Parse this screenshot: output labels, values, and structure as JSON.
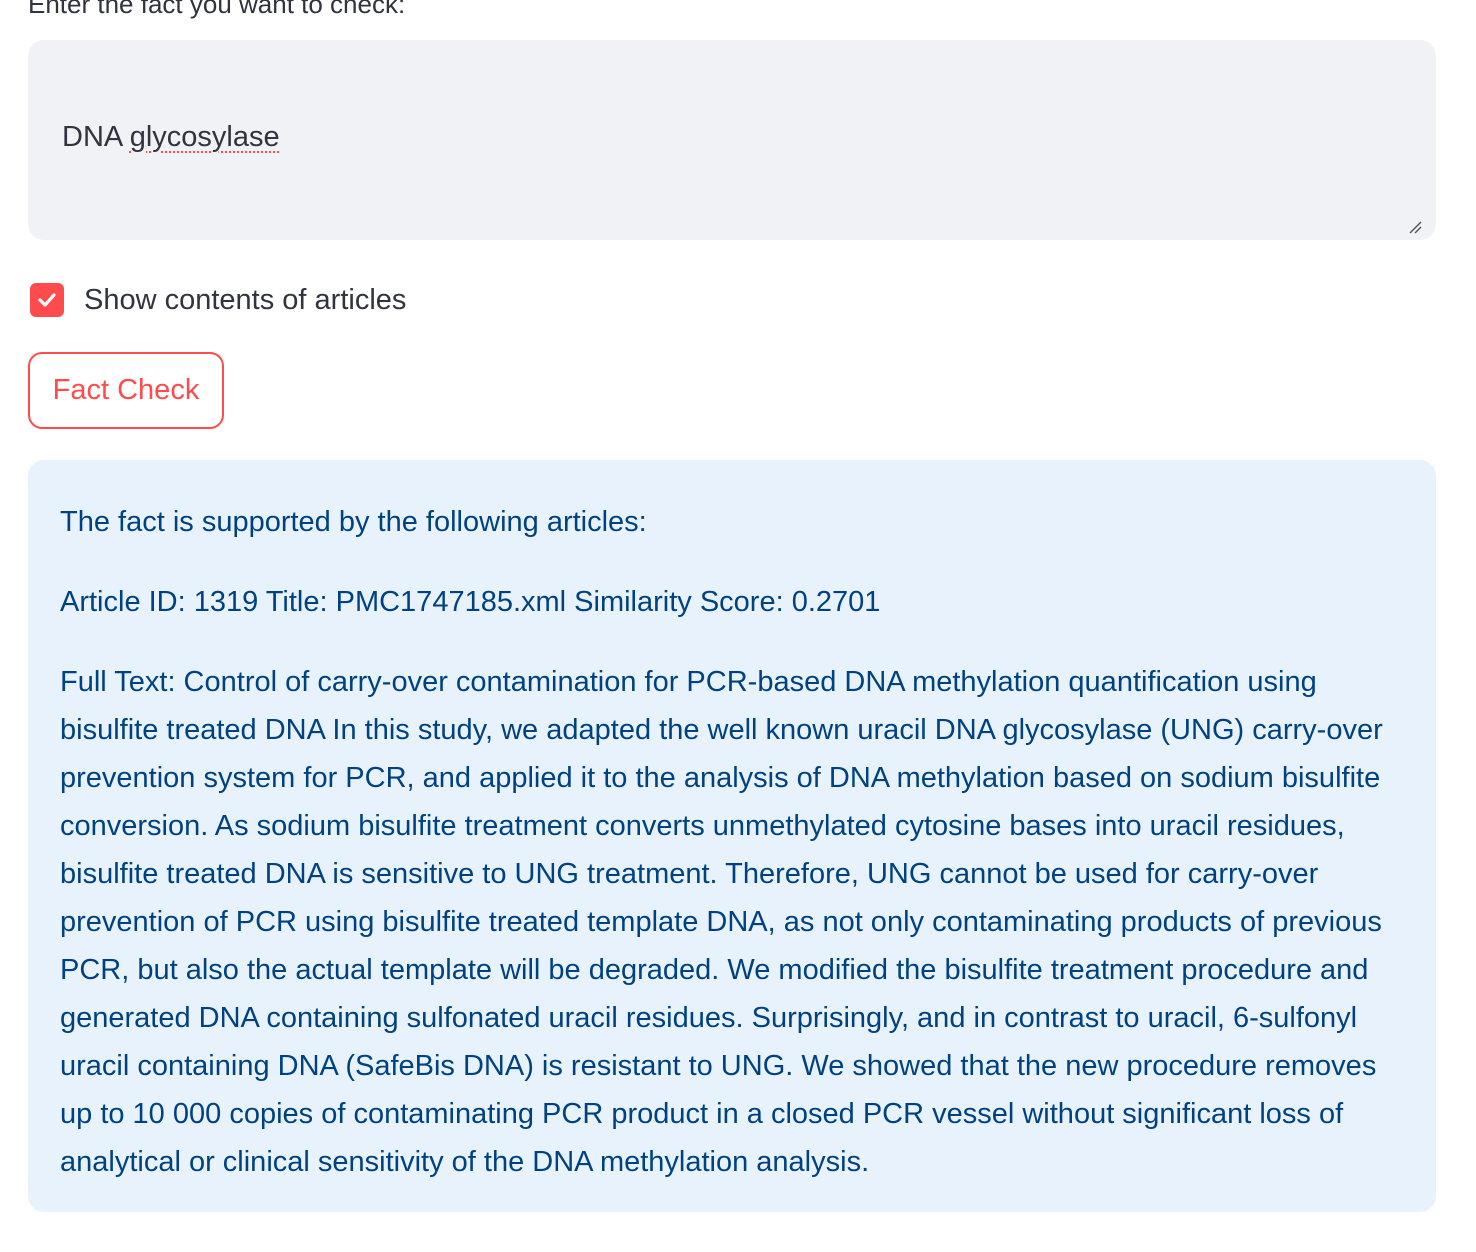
{
  "form": {
    "label": "Enter the fact you want to check:",
    "input_value_word1": "DNA",
    "input_value_word2": "glycosylase"
  },
  "options": {
    "show_contents_label": "Show contents of articles",
    "show_contents_checked": true
  },
  "actions": {
    "fact_check_label": "Fact Check"
  },
  "result": {
    "heading": "The fact is supported by the following articles:",
    "article_line": "Article ID: 1319 Title: PMC1747185.xml Similarity Score: 0.2701",
    "full_text": "Full Text: Control of carry-over contamination for PCR-based DNA methylation quantification using bisulfite treated DNA In this study, we adapted the well known uracil DNA glycosylase (UNG) carry-over prevention system for PCR, and applied it to the analysis of DNA methylation based on sodium bisulfite conversion. As sodium bisulfite treatment converts unmethylated cytosine bases into uracil residues, bisulfite treated DNA is sensitive to UNG treatment. Therefore, UNG cannot be used for carry-over prevention of PCR using bisulfite treated template DNA, as not only contaminating products of previous PCR, but also the actual template will be degraded. We modified the bisulfite treatment procedure and generated DNA containing sulfonated uracil residues. Surprisingly, and in contrast to uracil, 6-sulfonyl uracil containing DNA (SafeBis DNA) is resistant to UNG. We showed that the new procedure removes up to 10 000 copies of contaminating PCR product in a closed PCR vessel without significant loss of analytical or clinical sensitivity of the DNA methylation analysis."
  },
  "colors": {
    "accent": "#ff4b4b",
    "input_bg": "#f0f2f6",
    "info_bg": "#e8f2fc",
    "info_text": "#004280",
    "text": "#31333f"
  },
  "icons": {
    "checkbox": "checkmark-icon",
    "resize": "resize-handle-icon"
  }
}
